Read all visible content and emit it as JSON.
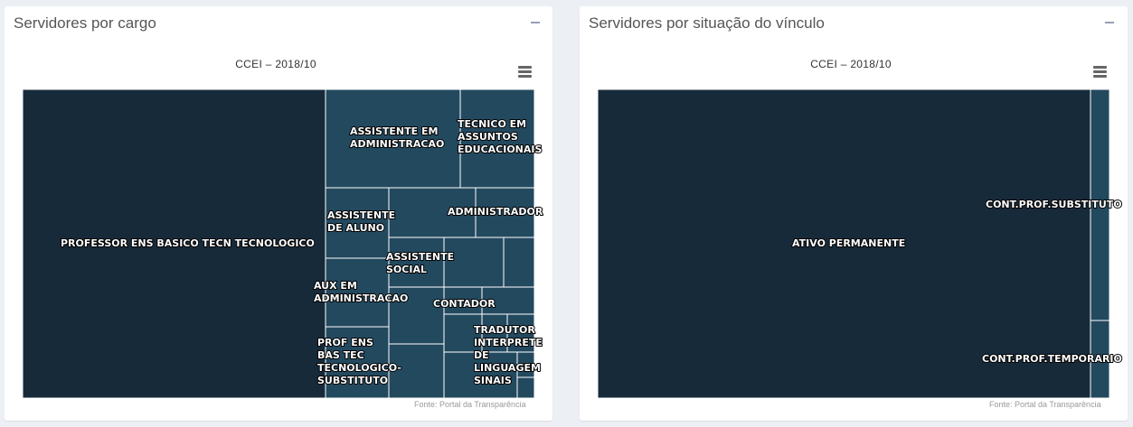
{
  "panels": [
    {
      "title": "Servidores por cargo",
      "subtitle": "CCEI – 2018/10",
      "credit": "Fonte: Portal da Transparência"
    },
    {
      "title": "Servidores por situação do vínculo",
      "subtitle": "CCEI – 2018/10",
      "credit": "Fonte: Portal da Transparência"
    }
  ],
  "icons": {
    "collapse": "minus-icon",
    "menu": "hamburger-menu-icon"
  },
  "colors": {
    "dominant": "#172a3a",
    "secondary": "#23495f",
    "cell_border": "#ffffff",
    "page_background": "#ecf0f5"
  },
  "chart_data": [
    {
      "type": "treemap",
      "title": "CCEI – 2018/10",
      "values_are_relative_area": true,
      "items": [
        {
          "name": "PROFESSOR ENS BASICO TECN TECNOLOGICO",
          "value": 59.3
        },
        {
          "name": "ASSISTENTE EM ADMINISTRACAO",
          "value": 8.4
        },
        {
          "name": "TECNICO EM ASSUNTOS EDUCACIONAIS",
          "value": 4.9
        },
        {
          "name": "ASSISTENTE DE ALUNO",
          "value": 2.8
        },
        {
          "name": "ADMINISTRADOR",
          "value": 2.8
        },
        {
          "name": "",
          "value": 2.3
        },
        {
          "name": "ASSISTENTE SOCIAL",
          "value": 2.0
        },
        {
          "name": "",
          "value": 1.9
        },
        {
          "name": "",
          "value": 1.2
        },
        {
          "name": "AUX EM ADMINISTRACAO",
          "value": 2.3
        },
        {
          "name": "",
          "value": 1.9
        },
        {
          "name": "CONTADOR",
          "value": 1.0
        },
        {
          "name": "",
          "value": 1.2
        },
        {
          "name": "PROF ENS BAS TEC TECNOLOGICO-SUBSTITUTO",
          "value": 2.0
        },
        {
          "name": "",
          "value": 1.6
        },
        {
          "name": "",
          "value": 1.6
        },
        {
          "name": "",
          "value": 0.5
        },
        {
          "name": "",
          "value": 0.4
        },
        {
          "name": "TRADUTOR INTERPRETE DE LINGUAGEM SINAIS",
          "value": 0.5
        },
        {
          "name": "",
          "value": 0.3
        },
        {
          "name": "",
          "value": 0.3
        }
      ]
    },
    {
      "type": "treemap",
      "title": "CCEI – 2018/10",
      "values_are_relative_area": true,
      "items": [
        {
          "name": "ATIVO PERMANENTE",
          "value": 96.3
        },
        {
          "name": "CONT.PROF.SUBSTITUTO",
          "value": 2.7
        },
        {
          "name": "CONT.PROF.TEMPORARIO",
          "value": 1.0
        }
      ]
    }
  ]
}
